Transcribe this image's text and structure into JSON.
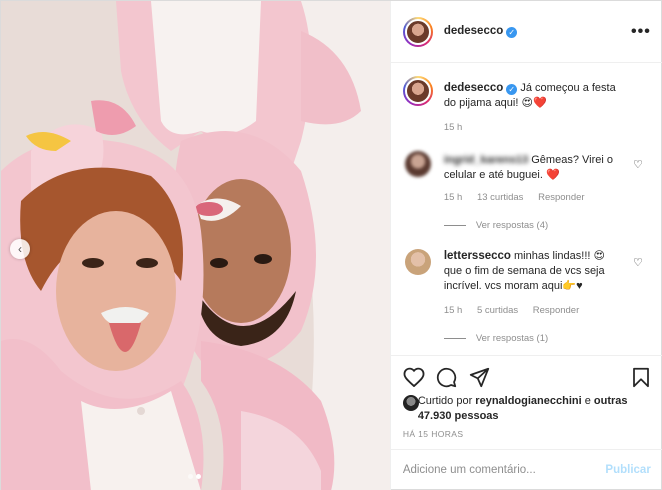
{
  "header": {
    "username": "dedesecco",
    "more_icon": "more-horizontal-icon"
  },
  "caption": {
    "username": "dedesecco",
    "text": "Já começou a festa do pijama aqui!",
    "emojis": "😍❤️",
    "time": "15 h"
  },
  "comments": [
    {
      "username": "ingrid_karens13",
      "text": "Gêmeas? Virei o celular e até buguei.",
      "emoji": "❤️",
      "time": "15 h",
      "likes": "13 curtidas",
      "reply": "Responder",
      "view_replies": "Ver respostas (4)"
    },
    {
      "username": "letterssecco",
      "text": "minhas lindas!!!",
      "text2": "que o fim de semana de vcs seja incrível. vcs moram aqui",
      "emoji": "😍",
      "emoji2": "👉♥",
      "time": "15 h",
      "likes": "5 curtidas",
      "reply": "Responder",
      "view_replies": "Ver respostas (1)"
    }
  ],
  "likes": {
    "prefix": "Curtido por",
    "user": "reynaldogianecchini",
    "connector": "e",
    "others": "outras 47.930 pessoas"
  },
  "date": "HÁ 15 HORAS",
  "add_comment": {
    "placeholder": "Adicione um comentário...",
    "publish_label": "Publicar"
  },
  "carousel": {
    "total": 2,
    "active": 2
  },
  "colors": {
    "verified": "#3897f0",
    "publish_disabled": "#b2dffc",
    "text": "#262626",
    "muted": "#8e8e8e"
  }
}
